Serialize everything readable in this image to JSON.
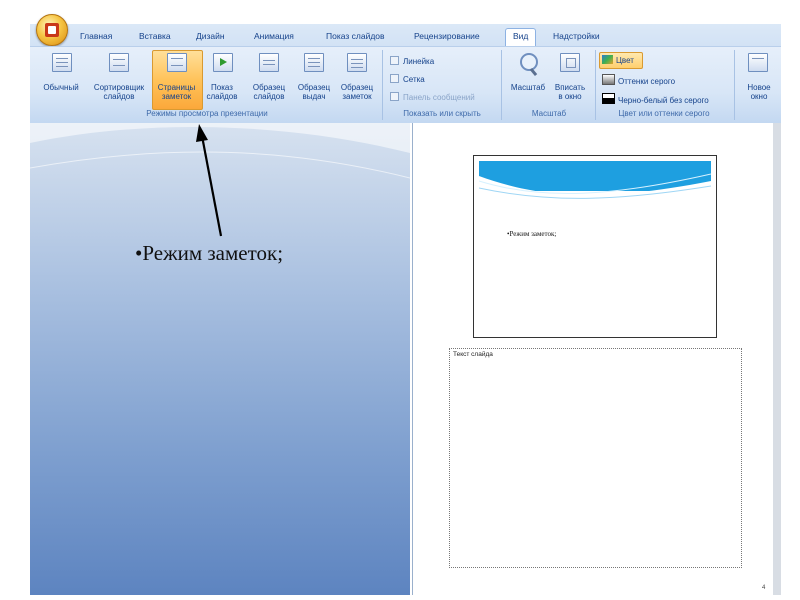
{
  "ribbon": {
    "tabs": [
      "Главная",
      "Вставка",
      "Дизайн",
      "Анимация",
      "Показ слайдов",
      "Рецензирование",
      "Вид",
      "Надстройки"
    ],
    "active_tab": "Вид",
    "view_buttons": [
      {
        "line1": "Обычный",
        "line2": ""
      },
      {
        "line1": "Сортировщик",
        "line2": "слайдов"
      },
      {
        "line1": "Страницы",
        "line2": "заметок"
      },
      {
        "line1": "Показ",
        "line2": "слайдов"
      },
      {
        "line1": "Образец",
        "line2": "слайдов"
      },
      {
        "line1": "Образец",
        "line2": "выдач"
      },
      {
        "line1": "Образец",
        "line2": "заметок"
      }
    ],
    "groups": {
      "views": "Режимы просмотра презентации",
      "show_hide": "Показать или скрыть",
      "zoom": "Масштаб",
      "color": "Цвет или оттенки серого"
    },
    "checkboxes": [
      {
        "label": "Линейка",
        "enabled": true
      },
      {
        "label": "Сетка",
        "enabled": true
      },
      {
        "label": "Панель сообщений",
        "enabled": false
      }
    ],
    "zoom_buttons": [
      {
        "line1": "Масштаб",
        "line2": ""
      },
      {
        "line1": "Вписать",
        "line2": "в окно"
      }
    ],
    "color_options": [
      "Цвет",
      "Оттенки серого",
      "Черно-белый без серого"
    ],
    "window_button": {
      "line1": "Новое",
      "line2": "окно"
    }
  },
  "slide": {
    "bullet": "•Режим заметок;"
  },
  "notes_page": {
    "thumb_text": "•Режим заметок;",
    "notes_placeholder": "Текст слайда",
    "page_number": "4"
  },
  "colors": {
    "ribbon": "#dbe8f7",
    "ribbon_text": "#15428b",
    "active_button": "#ffc35a",
    "slide_gradient_bottom": "#5d84c0",
    "thumb_wave": "#1e9fe0"
  },
  "icons": [
    "office-logo-icon",
    "normal-view-icon",
    "slide-sorter-icon",
    "notes-page-icon",
    "slide-show-icon",
    "slide-master-icon",
    "handout-master-icon",
    "notes-master-icon",
    "zoom-icon",
    "fit-window-icon",
    "new-window-icon"
  ]
}
